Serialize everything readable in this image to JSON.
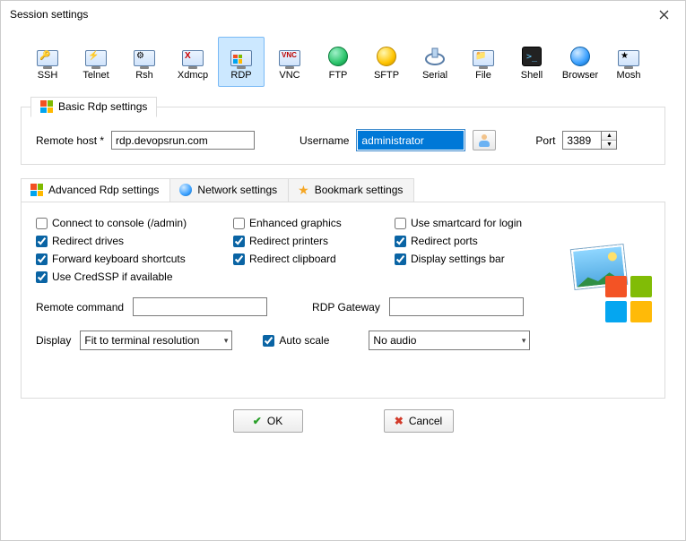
{
  "window": {
    "title": "Session settings"
  },
  "types": [
    {
      "key": "ssh",
      "label": "SSH"
    },
    {
      "key": "telnet",
      "label": "Telnet"
    },
    {
      "key": "rsh",
      "label": "Rsh"
    },
    {
      "key": "xdmcp",
      "label": "Xdmcp"
    },
    {
      "key": "rdp",
      "label": "RDP",
      "selected": true
    },
    {
      "key": "vnc",
      "label": "VNC"
    },
    {
      "key": "ftp",
      "label": "FTP"
    },
    {
      "key": "sftp",
      "label": "SFTP"
    },
    {
      "key": "serial",
      "label": "Serial"
    },
    {
      "key": "file",
      "label": "File"
    },
    {
      "key": "shell",
      "label": "Shell"
    },
    {
      "key": "browser",
      "label": "Browser"
    },
    {
      "key": "mosh",
      "label": "Mosh"
    }
  ],
  "basic": {
    "legend": "Basic Rdp settings",
    "remote_host_label": "Remote host *",
    "remote_host_value": "rdp.devopsrun.com",
    "username_label": "Username",
    "username_value": "administrator",
    "port_label": "Port",
    "port_value": "3389"
  },
  "tabs": {
    "advanced": "Advanced Rdp settings",
    "network": "Network settings",
    "bookmark": "Bookmark settings",
    "active": "advanced"
  },
  "advanced": {
    "checks": {
      "connect_console": {
        "label": "Connect to console (/admin)",
        "checked": false
      },
      "enhanced_graphics": {
        "label": "Enhanced graphics",
        "checked": false
      },
      "smartcard": {
        "label": "Use smartcard for login",
        "checked": false
      },
      "redirect_drives": {
        "label": "Redirect drives",
        "checked": true
      },
      "redirect_printers": {
        "label": "Redirect printers",
        "checked": true
      },
      "redirect_ports": {
        "label": "Redirect ports",
        "checked": true
      },
      "fwd_keyboard": {
        "label": "Forward keyboard shortcuts",
        "checked": true
      },
      "redirect_clipboard": {
        "label": "Redirect clipboard",
        "checked": true
      },
      "display_settings": {
        "label": "Display settings bar",
        "checked": true
      },
      "use_credssp": {
        "label": "Use CredSSP if available",
        "checked": true
      }
    },
    "remote_command_label": "Remote command",
    "remote_command_value": "",
    "rdp_gateway_label": "RDP Gateway",
    "rdp_gateway_value": "",
    "display_label": "Display",
    "display_value": "Fit to terminal resolution",
    "autoscale_label": "Auto scale",
    "autoscale_checked": true,
    "audio_value": "No audio"
  },
  "buttons": {
    "ok": "OK",
    "cancel": "Cancel"
  }
}
